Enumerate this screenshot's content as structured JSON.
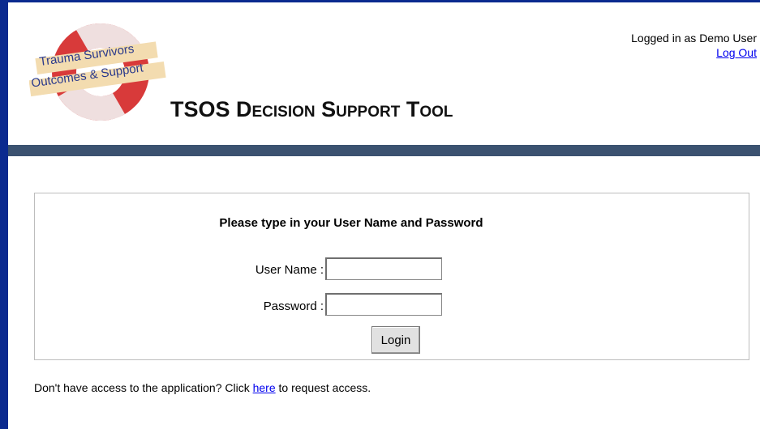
{
  "logo": {
    "line1": "Trauma Survivors",
    "line2": "Outcomes & Support",
    "ring_color": "#d83a3a",
    "band_color": "#f3dcb0",
    "text_color": "#2b3a8c"
  },
  "user": {
    "status": "Logged in as Demo User",
    "logout_label": "Log Out"
  },
  "app": {
    "title": "TSOS Decision Support Tool"
  },
  "colors": {
    "frame": "#0b2a8f",
    "banner": "#3b5270",
    "link": "#0000ee"
  },
  "login": {
    "heading": "Please type in your User Name and Password",
    "username_label": "User Name :",
    "username_value": "",
    "password_label": "Password :",
    "password_value": "",
    "button_label": "Login"
  },
  "access": {
    "prefix": "Don't have access to the application? Click ",
    "link_label": "here",
    "suffix": " to request access."
  }
}
